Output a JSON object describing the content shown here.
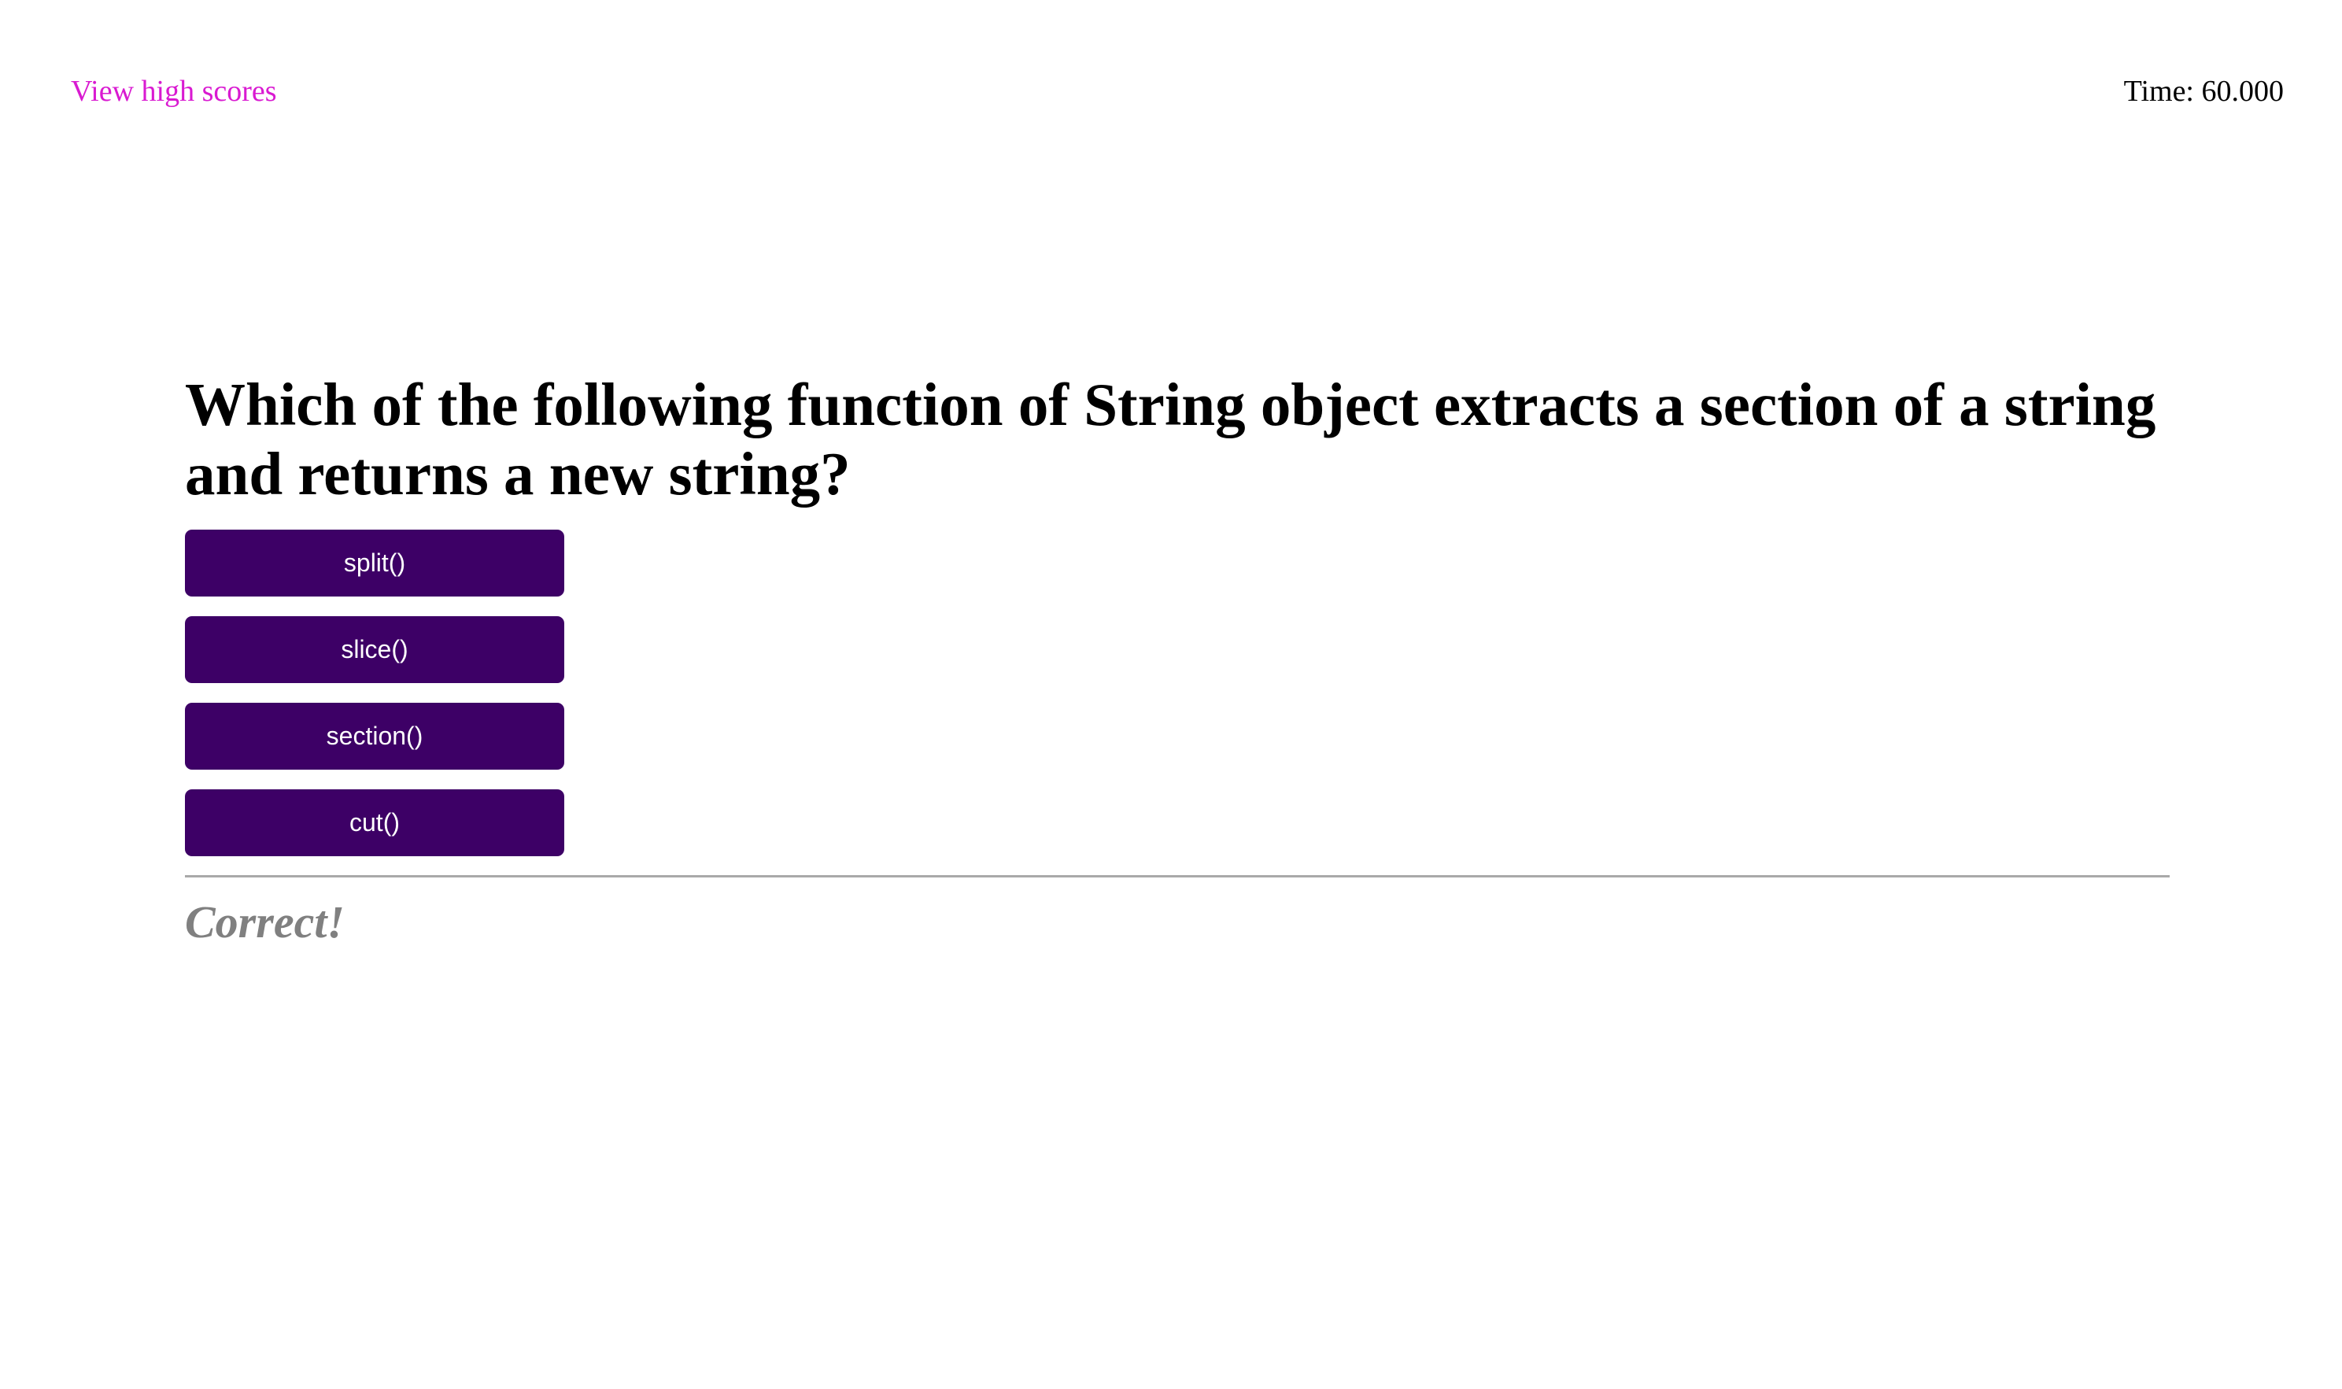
{
  "header": {
    "high_scores_link": "View high scores",
    "timer_text": "Time: 60.000"
  },
  "quiz": {
    "question": "Which of the following function of String object extracts a section of a string and returns a new string?",
    "answers": [
      "split()",
      "slice()",
      "section()",
      "cut()"
    ],
    "feedback": "Correct!"
  },
  "colors": {
    "link": "#d91ad1",
    "button_background": "#3d0066",
    "button_text": "#ffffff",
    "feedback_text": "#808080",
    "divider": "#a9a9a9"
  }
}
